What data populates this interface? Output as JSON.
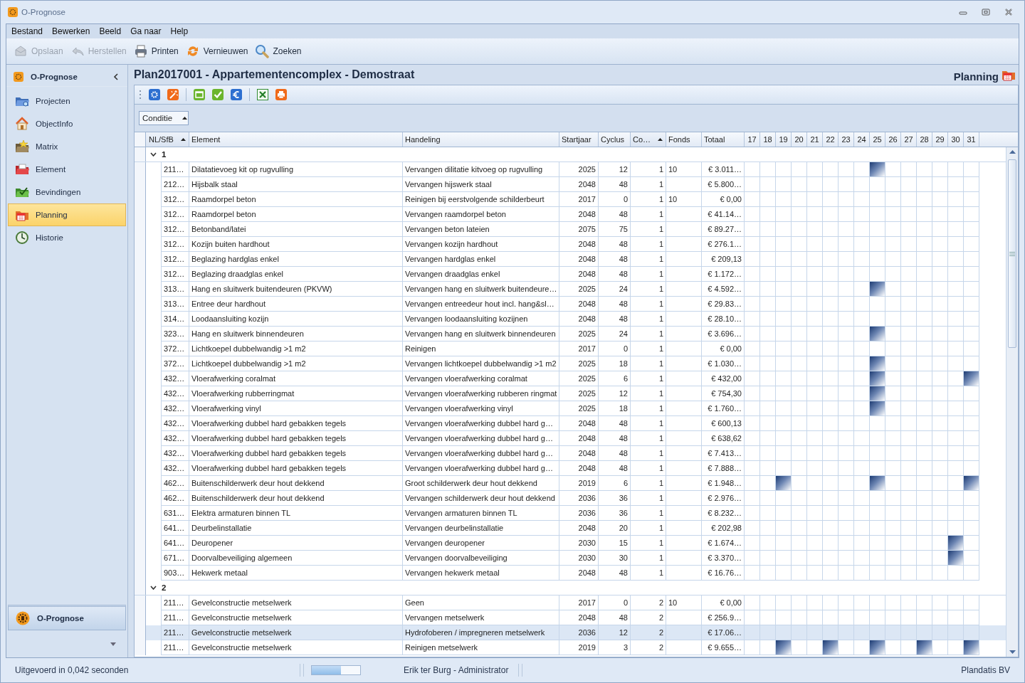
{
  "window": {
    "title": "O-Prognose"
  },
  "menu": [
    "Bestand",
    "Bewerken",
    "Beeld",
    "Ga naar",
    "Help"
  ],
  "toolbar": [
    {
      "label": "Opslaan",
      "disabled": true
    },
    {
      "label": "Herstellen",
      "disabled": true
    },
    {
      "label": "Printen",
      "disabled": false
    },
    {
      "label": "Vernieuwen",
      "disabled": false
    },
    {
      "label": "Zoeken",
      "disabled": false
    }
  ],
  "sidebar": {
    "title": "O-Prognose",
    "items": [
      {
        "label": "Projecten",
        "selected": false
      },
      {
        "label": "ObjectInfo",
        "selected": false
      },
      {
        "label": "Matrix",
        "selected": false
      },
      {
        "label": "Element",
        "selected": false
      },
      {
        "label": "Bevindingen",
        "selected": false
      },
      {
        "label": "Planning",
        "selected": true
      },
      {
        "label": "Historie",
        "selected": false
      }
    ],
    "footer_button": "O-Prognose"
  },
  "content": {
    "title": "Plan2017001 - Appartementencomplex - Demostraat",
    "section": "Planning"
  },
  "group_by": {
    "label": "Conditie"
  },
  "grid": {
    "columns": [
      {
        "label": "NL/SfB",
        "sorted": true
      },
      {
        "label": "Element",
        "sorted": false
      },
      {
        "label": "Handeling",
        "sorted": false
      },
      {
        "label": "Startjaar",
        "sorted": false
      },
      {
        "label": "Cyclus",
        "sorted": false
      },
      {
        "label": "Co…",
        "sorted": true
      },
      {
        "label": "Fonds",
        "sorted": false
      },
      {
        "label": "Totaal",
        "sorted": false
      }
    ],
    "year_columns": [
      "17",
      "18",
      "19",
      "20",
      "21",
      "22",
      "23",
      "24",
      "25",
      "26",
      "27",
      "28",
      "29",
      "30",
      "31"
    ],
    "groups": [
      {
        "label": "1",
        "expanded": true,
        "rows": [
          {
            "code": "211…",
            "element": "Dilatatievoeg kit op rugvulling",
            "handeling": "Vervangen dilitatie kitvoeg op rugvulling",
            "startjaar": "2025",
            "cyclus": "12",
            "conditie": "1",
            "fonds": "10",
            "totaal": "€ 3.011…",
            "selected": false,
            "planned": [
              false,
              false,
              false,
              false,
              false,
              false,
              false,
              false,
              true,
              false,
              false,
              false,
              false,
              false,
              false
            ]
          },
          {
            "code": "212…",
            "element": "Hijsbalk staal",
            "handeling": "Vervangen hijswerk staal",
            "startjaar": "2048",
            "cyclus": "48",
            "conditie": "1",
            "totaal": "€ 5.800…",
            "selected": false,
            "planned": [
              false,
              false,
              false,
              false,
              false,
              false,
              false,
              false,
              false,
              false,
              false,
              false,
              false,
              false,
              false
            ]
          },
          {
            "code": "312…",
            "element": "Raamdorpel beton",
            "handeling": "Reinigen bij eerstvolgende schilderbeurt",
            "startjaar": "2017",
            "cyclus": "0",
            "conditie": "1",
            "fonds": "10",
            "totaal": "€ 0,00",
            "selected": false,
            "planned": [
              false,
              false,
              false,
              false,
              false,
              false,
              false,
              false,
              false,
              false,
              false,
              false,
              false,
              false,
              false
            ]
          },
          {
            "code": "312…",
            "element": "Raamdorpel beton",
            "handeling": "Vervangen raamdorpel beton",
            "startjaar": "2048",
            "cyclus": "48",
            "conditie": "1",
            "totaal": "€ 41.14…",
            "selected": false,
            "planned": [
              false,
              false,
              false,
              false,
              false,
              false,
              false,
              false,
              false,
              false,
              false,
              false,
              false,
              false,
              false
            ]
          },
          {
            "code": "312…",
            "element": "Betonband/latei",
            "handeling": "Vervangen beton lateien",
            "startjaar": "2075",
            "cyclus": "75",
            "conditie": "1",
            "totaal": "€ 89.27…",
            "selected": false,
            "planned": [
              false,
              false,
              false,
              false,
              false,
              false,
              false,
              false,
              false,
              false,
              false,
              false,
              false,
              false,
              false
            ]
          },
          {
            "code": "312…",
            "element": "Kozijn buiten hardhout",
            "handeling": "Vervangen kozijn hardhout",
            "startjaar": "2048",
            "cyclus": "48",
            "conditie": "1",
            "totaal": "€ 276.1…",
            "selected": false,
            "planned": [
              false,
              false,
              false,
              false,
              false,
              false,
              false,
              false,
              false,
              false,
              false,
              false,
              false,
              false,
              false
            ]
          },
          {
            "code": "312…",
            "element": "Beglazing hardglas enkel",
            "handeling": "Vervangen hardglas enkel",
            "startjaar": "2048",
            "cyclus": "48",
            "conditie": "1",
            "totaal": "€ 209,13",
            "selected": false,
            "planned": [
              false,
              false,
              false,
              false,
              false,
              false,
              false,
              false,
              false,
              false,
              false,
              false,
              false,
              false,
              false
            ]
          },
          {
            "code": "312…",
            "element": "Beglazing draadglas enkel",
            "handeling": "Vervangen draadglas enkel",
            "startjaar": "2048",
            "cyclus": "48",
            "conditie": "1",
            "totaal": "€ 1.172…",
            "selected": false,
            "planned": [
              false,
              false,
              false,
              false,
              false,
              false,
              false,
              false,
              false,
              false,
              false,
              false,
              false,
              false,
              false
            ]
          },
          {
            "code": "313…",
            "element": "Hang en sluitwerk buitendeuren (PKVW)",
            "handeling": "Vervangen hang en sluitwerk buitendeure…",
            "startjaar": "2025",
            "cyclus": "24",
            "conditie": "1",
            "totaal": "€ 4.592…",
            "selected": false,
            "planned": [
              false,
              false,
              false,
              false,
              false,
              false,
              false,
              false,
              true,
              false,
              false,
              false,
              false,
              false,
              false
            ]
          },
          {
            "code": "313…",
            "element": "Entree deur hardhout",
            "handeling": "Vervangen entreedeur hout incl. hang&sl…",
            "startjaar": "2048",
            "cyclus": "48",
            "conditie": "1",
            "totaal": "€ 29.83…",
            "selected": false,
            "planned": [
              false,
              false,
              false,
              false,
              false,
              false,
              false,
              false,
              false,
              false,
              false,
              false,
              false,
              false,
              false
            ]
          },
          {
            "code": "314…",
            "element": "Loodaansluiting kozijn",
            "handeling": "Vervangen loodaansluiting kozijnen",
            "startjaar": "2048",
            "cyclus": "48",
            "conditie": "1",
            "totaal": "€ 28.10…",
            "selected": false,
            "planned": [
              false,
              false,
              false,
              false,
              false,
              false,
              false,
              false,
              false,
              false,
              false,
              false,
              false,
              false,
              false
            ]
          },
          {
            "code": "323…",
            "element": "Hang en sluitwerk binnendeuren",
            "handeling": "Vervangen hang en sluitwerk binnendeuren",
            "startjaar": "2025",
            "cyclus": "24",
            "conditie": "1",
            "totaal": "€ 3.696…",
            "selected": false,
            "planned": [
              false,
              false,
              false,
              false,
              false,
              false,
              false,
              false,
              true,
              false,
              false,
              false,
              false,
              false,
              false
            ]
          },
          {
            "code": "372…",
            "element": "Lichtkoepel dubbelwandig >1 m2",
            "handeling": "Reinigen",
            "startjaar": "2017",
            "cyclus": "0",
            "conditie": "1",
            "totaal": "€ 0,00",
            "selected": false,
            "planned": [
              false,
              false,
              false,
              false,
              false,
              false,
              false,
              false,
              false,
              false,
              false,
              false,
              false,
              false,
              false
            ]
          },
          {
            "code": "372…",
            "element": "Lichtkoepel dubbelwandig >1 m2",
            "handeling": "Vervangen lichtkoepel dubbelwandig >1 m2",
            "startjaar": "2025",
            "cyclus": "18",
            "conditie": "1",
            "totaal": "€ 1.030…",
            "selected": false,
            "planned": [
              false,
              false,
              false,
              false,
              false,
              false,
              false,
              false,
              true,
              false,
              false,
              false,
              false,
              false,
              false
            ]
          },
          {
            "code": "432…",
            "element": "Vloerafwerking coralmat",
            "handeling": "Vervangen vloerafwerking coralmat",
            "startjaar": "2025",
            "cyclus": "6",
            "conditie": "1",
            "totaal": "€ 432,00",
            "selected": false,
            "planned": [
              false,
              false,
              false,
              false,
              false,
              false,
              false,
              false,
              true,
              false,
              false,
              false,
              false,
              false,
              true
            ]
          },
          {
            "code": "432…",
            "element": "Vloerafwerking rubberringmat",
            "handeling": "Vervangen vloerafwerking rubberen ringmat",
            "startjaar": "2025",
            "cyclus": "12",
            "conditie": "1",
            "totaal": "€ 754,30",
            "selected": false,
            "planned": [
              false,
              false,
              false,
              false,
              false,
              false,
              false,
              false,
              true,
              false,
              false,
              false,
              false,
              false,
              false
            ]
          },
          {
            "code": "432…",
            "element": "Vloerafwerking vinyl",
            "handeling": "Vervangen vloerafwerking vinyl",
            "startjaar": "2025",
            "cyclus": "18",
            "conditie": "1",
            "totaal": "€ 1.760…",
            "selected": false,
            "planned": [
              false,
              false,
              false,
              false,
              false,
              false,
              false,
              false,
              true,
              false,
              false,
              false,
              false,
              false,
              false
            ]
          },
          {
            "code": "432…",
            "element": "Vloerafwerking dubbel hard gebakken tegels",
            "handeling": "Vervangen vloerafwerking dubbel hard g…",
            "startjaar": "2048",
            "cyclus": "48",
            "conditie": "1",
            "totaal": "€ 600,13",
            "selected": false,
            "planned": [
              false,
              false,
              false,
              false,
              false,
              false,
              false,
              false,
              false,
              false,
              false,
              false,
              false,
              false,
              false
            ]
          },
          {
            "code": "432…",
            "element": "Vloerafwerking dubbel hard gebakken tegels",
            "handeling": "Vervangen vloerafwerking dubbel hard g…",
            "startjaar": "2048",
            "cyclus": "48",
            "conditie": "1",
            "totaal": "€ 638,62",
            "selected": false,
            "planned": [
              false,
              false,
              false,
              false,
              false,
              false,
              false,
              false,
              false,
              false,
              false,
              false,
              false,
              false,
              false
            ]
          },
          {
            "code": "432…",
            "element": "Vloerafwerking dubbel hard gebakken tegels",
            "handeling": "Vervangen vloerafwerking dubbel hard g…",
            "startjaar": "2048",
            "cyclus": "48",
            "conditie": "1",
            "totaal": "€ 7.413…",
            "selected": false,
            "planned": [
              false,
              false,
              false,
              false,
              false,
              false,
              false,
              false,
              false,
              false,
              false,
              false,
              false,
              false,
              false
            ]
          },
          {
            "code": "432…",
            "element": "Vloerafwerking dubbel hard gebakken tegels",
            "handeling": "Vervangen vloerafwerking dubbel hard g…",
            "startjaar": "2048",
            "cyclus": "48",
            "conditie": "1",
            "totaal": "€ 7.888…",
            "selected": false,
            "planned": [
              false,
              false,
              false,
              false,
              false,
              false,
              false,
              false,
              false,
              false,
              false,
              false,
              false,
              false,
              false
            ]
          },
          {
            "code": "462…",
            "element": "Buitenschilderwerk deur hout dekkend",
            "handeling": "Groot schilderwerk deur hout dekkend",
            "startjaar": "2019",
            "cyclus": "6",
            "conditie": "1",
            "totaal": "€ 1.948…",
            "selected": false,
            "planned": [
              false,
              false,
              true,
              false,
              false,
              false,
              false,
              false,
              true,
              false,
              false,
              false,
              false,
              false,
              true
            ]
          },
          {
            "code": "462…",
            "element": "Buitenschilderwerk deur hout dekkend",
            "handeling": "Vervangen schilderwerk deur hout dekkend",
            "startjaar": "2036",
            "cyclus": "36",
            "conditie": "1",
            "totaal": "€ 2.976…",
            "selected": false,
            "planned": [
              false,
              false,
              false,
              false,
              false,
              false,
              false,
              false,
              false,
              false,
              false,
              false,
              false,
              false,
              false
            ]
          },
          {
            "code": "631…",
            "element": "Elektra armaturen binnen TL",
            "handeling": "Vervangen armaturen binnen TL",
            "startjaar": "2036",
            "cyclus": "36",
            "conditie": "1",
            "totaal": "€ 8.232…",
            "selected": false,
            "planned": [
              false,
              false,
              false,
              false,
              false,
              false,
              false,
              false,
              false,
              false,
              false,
              false,
              false,
              false,
              false
            ]
          },
          {
            "code": "641…",
            "element": "Deurbelinstallatie",
            "handeling": "Vervangen deurbelinstallatie",
            "startjaar": "2048",
            "cyclus": "20",
            "conditie": "1",
            "totaal": "€ 202,98",
            "selected": false,
            "planned": [
              false,
              false,
              false,
              false,
              false,
              false,
              false,
              false,
              false,
              false,
              false,
              false,
              false,
              false,
              false
            ]
          },
          {
            "code": "641…",
            "element": "Deuropener",
            "handeling": "Vervangen deuropener",
            "startjaar": "2030",
            "cyclus": "15",
            "conditie": "1",
            "totaal": "€ 1.674…",
            "selected": false,
            "planned": [
              false,
              false,
              false,
              false,
              false,
              false,
              false,
              false,
              false,
              false,
              false,
              false,
              false,
              true,
              false
            ]
          },
          {
            "code": "671…",
            "element": "Doorvalbeveiliging algemeen",
            "handeling": "Vervangen doorvalbeveiliging",
            "startjaar": "2030",
            "cyclus": "30",
            "conditie": "1",
            "totaal": "€ 3.370…",
            "selected": false,
            "planned": [
              false,
              false,
              false,
              false,
              false,
              false,
              false,
              false,
              false,
              false,
              false,
              false,
              false,
              true,
              false
            ]
          },
          {
            "code": "903…",
            "element": "Hekwerk metaal",
            "handeling": "Vervangen hekwerk metaal",
            "startjaar": "2048",
            "cyclus": "48",
            "conditie": "1",
            "totaal": "€ 16.76…",
            "selected": false,
            "planned": [
              false,
              false,
              false,
              false,
              false,
              false,
              false,
              false,
              false,
              false,
              false,
              false,
              false,
              false,
              false
            ]
          }
        ]
      },
      {
        "label": "2",
        "expanded": true,
        "rows": [
          {
            "code": "211…",
            "element": "Gevelconstructie metselwerk",
            "handeling": "Geen",
            "startjaar": "2017",
            "cyclus": "0",
            "conditie": "2",
            "fonds": "10",
            "totaal": "€ 0,00",
            "selected": false,
            "planned": [
              false,
              false,
              false,
              false,
              false,
              false,
              false,
              false,
              false,
              false,
              false,
              false,
              false,
              false,
              false
            ]
          },
          {
            "code": "211…",
            "element": "Gevelconstructie metselwerk",
            "handeling": "Vervangen metselwerk",
            "startjaar": "2048",
            "cyclus": "48",
            "conditie": "2",
            "totaal": "€ 256.9…",
            "selected": false,
            "planned": [
              false,
              false,
              false,
              false,
              false,
              false,
              false,
              false,
              false,
              false,
              false,
              false,
              false,
              false,
              false
            ]
          },
          {
            "code": "211…",
            "element": "Gevelconstructie metselwerk",
            "handeling": "Hydrofoberen / impregneren metselwerk",
            "startjaar": "2036",
            "cyclus": "12",
            "conditie": "2",
            "totaal": "€ 17.06…",
            "selected": true,
            "planned": [
              false,
              false,
              false,
              false,
              false,
              false,
              false,
              false,
              false,
              false,
              false,
              false,
              false,
              false,
              false
            ]
          },
          {
            "code": "211…",
            "element": "Gevelconstructie metselwerk",
            "handeling": "Reinigen metselwerk",
            "startjaar": "2019",
            "cyclus": "3",
            "conditie": "2",
            "totaal": "€ 9.655…",
            "selected": false,
            "planned": [
              false,
              false,
              true,
              false,
              false,
              true,
              false,
              false,
              true,
              false,
              false,
              true,
              false,
              false,
              true
            ]
          }
        ]
      }
    ]
  },
  "status_bar": {
    "message": "Uitgevoerd in 0,042 seconden",
    "progress": {
      "level": 0.6
    },
    "user": "Erik ter Burg - Administrator",
    "company": "Plandatis BV"
  }
}
